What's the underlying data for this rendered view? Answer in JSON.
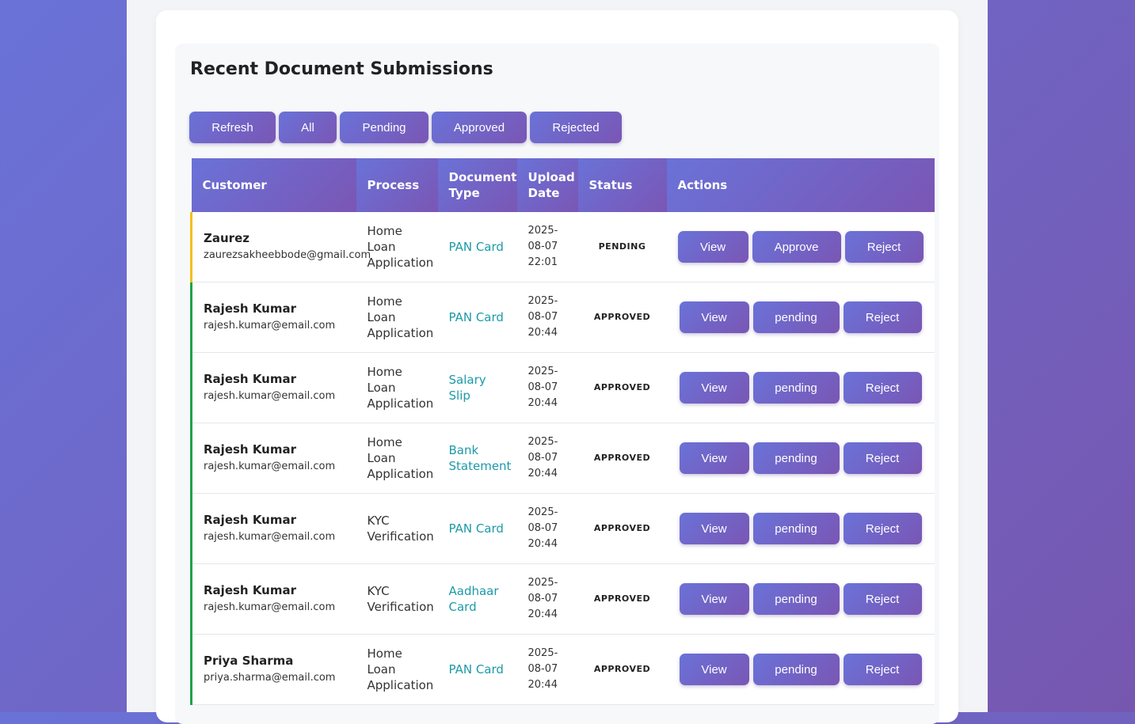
{
  "panel": {
    "title": "Recent Document Submissions"
  },
  "filters": [
    "Refresh",
    "All",
    "Pending",
    "Approved",
    "Rejected"
  ],
  "table": {
    "headers": {
      "customer": "Customer",
      "process": "Process",
      "document_type": "Document Type",
      "upload_date": "Upload Date",
      "status": "Status",
      "actions": "Actions"
    },
    "rows": [
      {
        "name": "Zaurez",
        "email": "zaurezsakheebbode@gmail.com",
        "process": "Home Loan Application",
        "document": "PAN Card",
        "date": "2025-08-07 22:01",
        "status": "PENDING",
        "actions": [
          "View",
          "Approve",
          "Reject"
        ],
        "state": "pending"
      },
      {
        "name": "Rajesh Kumar",
        "email": "rajesh.kumar@email.com",
        "process": "Home Loan Application",
        "document": "PAN Card",
        "date": "2025-08-07 20:44",
        "status": "APPROVED",
        "actions": [
          "View",
          "pending",
          "Reject"
        ],
        "state": "approved"
      },
      {
        "name": "Rajesh Kumar",
        "email": "rajesh.kumar@email.com",
        "process": "Home Loan Application",
        "document": "Salary Slip",
        "date": "2025-08-07 20:44",
        "status": "APPROVED",
        "actions": [
          "View",
          "pending",
          "Reject"
        ],
        "state": "approved"
      },
      {
        "name": "Rajesh Kumar",
        "email": "rajesh.kumar@email.com",
        "process": "Home Loan Application",
        "document": "Bank Statement",
        "date": "2025-08-07 20:44",
        "status": "APPROVED",
        "actions": [
          "View",
          "pending",
          "Reject"
        ],
        "state": "approved"
      },
      {
        "name": "Rajesh Kumar",
        "email": "rajesh.kumar@email.com",
        "process": "KYC Verification",
        "document": "PAN Card",
        "date": "2025-08-07 20:44",
        "status": "APPROVED",
        "actions": [
          "View",
          "pending",
          "Reject"
        ],
        "state": "approved"
      },
      {
        "name": "Rajesh Kumar",
        "email": "rajesh.kumar@email.com",
        "process": "KYC Verification",
        "document": "Aadhaar Card",
        "date": "2025-08-07 20:44",
        "status": "APPROVED",
        "actions": [
          "View",
          "pending",
          "Reject"
        ],
        "state": "approved"
      },
      {
        "name": "Priya Sharma",
        "email": "priya.sharma@email.com",
        "process": "Home Loan Application",
        "document": "PAN Card",
        "date": "2025-08-07 20:44",
        "status": "APPROVED",
        "actions": [
          "View",
          "pending",
          "Reject"
        ],
        "state": "approved"
      }
    ]
  },
  "colors": {
    "accent_start": "#6a72d8",
    "accent_end": "#7a56b4",
    "pending": "#f2c019",
    "approved": "#1fa34a",
    "link": "#1c9aa8"
  }
}
